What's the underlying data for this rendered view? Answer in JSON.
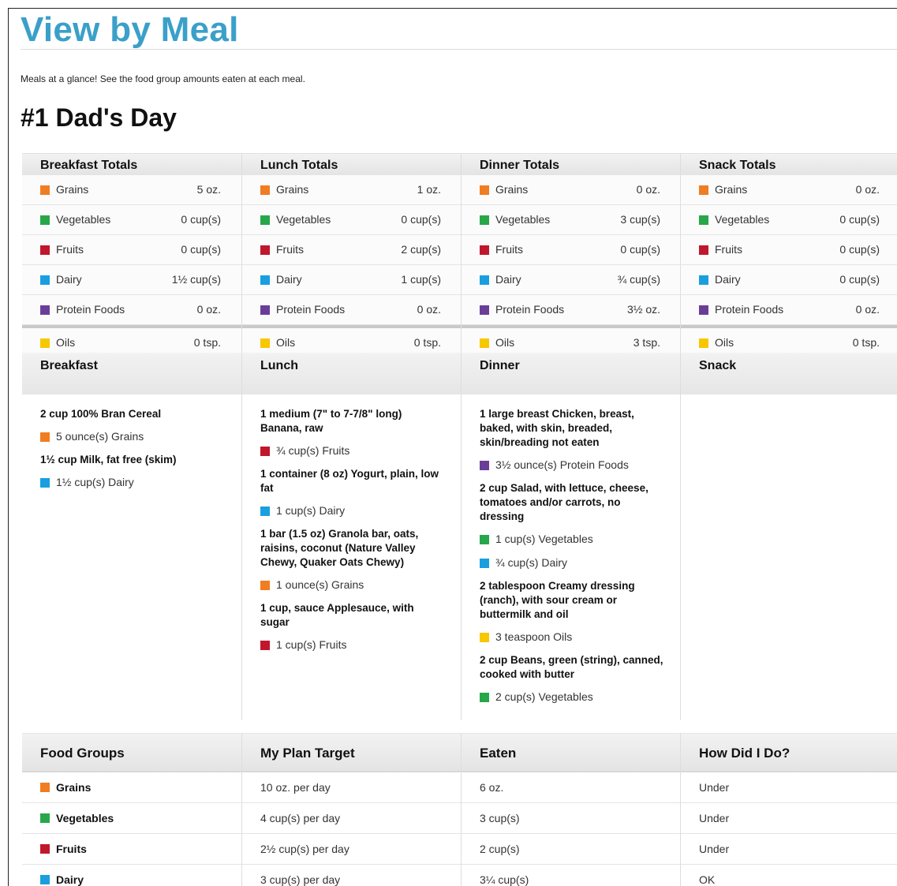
{
  "page": {
    "title": "View by Meal",
    "intro": "Meals at a glance! See the food group amounts eaten at each meal.",
    "day_title": "#1 Dad's Day"
  },
  "colors": {
    "grains": "#f07d22",
    "vegetables": "#27a74a",
    "fruits": "#c0172c",
    "dairy": "#1a9ee0",
    "protein": "#6a3e98",
    "oils": "#f7c700",
    "title": "#3aa0c9"
  },
  "totals": [
    {
      "heading": "Breakfast Totals",
      "rows": [
        {
          "label": "Grains",
          "value": "5 oz."
        },
        {
          "label": "Vegetables",
          "value": "0 cup(s)"
        },
        {
          "label": "Fruits",
          "value": "0 cup(s)"
        },
        {
          "label": "Dairy",
          "value": "1½ cup(s)"
        },
        {
          "label": "Protein Foods",
          "value": "0 oz."
        },
        {
          "label": "Oils",
          "value": "0 tsp."
        }
      ]
    },
    {
      "heading": "Lunch Totals",
      "rows": [
        {
          "label": "Grains",
          "value": "1 oz."
        },
        {
          "label": "Vegetables",
          "value": "0 cup(s)"
        },
        {
          "label": "Fruits",
          "value": "2 cup(s)"
        },
        {
          "label": "Dairy",
          "value": "1 cup(s)"
        },
        {
          "label": "Protein Foods",
          "value": "0 oz."
        },
        {
          "label": "Oils",
          "value": "0 tsp."
        }
      ]
    },
    {
      "heading": "Dinner Totals",
      "rows": [
        {
          "label": "Grains",
          "value": "0 oz."
        },
        {
          "label": "Vegetables",
          "value": "3 cup(s)"
        },
        {
          "label": "Fruits",
          "value": "0 cup(s)"
        },
        {
          "label": "Dairy",
          "value": "¾ cup(s)"
        },
        {
          "label": "Protein Foods",
          "value": "3½ oz."
        },
        {
          "label": "Oils",
          "value": "3 tsp."
        }
      ]
    },
    {
      "heading": "Snack Totals",
      "rows": [
        {
          "label": "Grains",
          "value": "0 oz."
        },
        {
          "label": "Vegetables",
          "value": "0 cup(s)"
        },
        {
          "label": "Fruits",
          "value": "0 cup(s)"
        },
        {
          "label": "Dairy",
          "value": "0 cup(s)"
        },
        {
          "label": "Protein Foods",
          "value": "0 oz."
        },
        {
          "label": "Oils",
          "value": "0 tsp."
        }
      ]
    }
  ],
  "meals": [
    {
      "heading": "Breakfast",
      "items": [
        {
          "food": "2 cup 100% Bran Cereal",
          "amount": "5 ounce(s) Grains",
          "group": "grains"
        },
        {
          "food": "1½ cup Milk, fat free (skim)",
          "amount": "1½ cup(s) Dairy",
          "group": "dairy"
        }
      ]
    },
    {
      "heading": "Lunch",
      "items": [
        {
          "food": "1 medium (7\" to 7-7/8\" long) Banana, raw",
          "amount": "¾ cup(s) Fruits",
          "group": "fruits"
        },
        {
          "food": "1 container (8 oz) Yogurt, plain, low fat",
          "amount": "1 cup(s) Dairy",
          "group": "dairy"
        },
        {
          "food": "1 bar (1.5 oz) Granola bar, oats, raisins, coconut (Nature Valley Chewy, Quaker Oats Chewy)",
          "amount": "1 ounce(s) Grains",
          "group": "grains"
        },
        {
          "food": "1 cup, sauce Applesauce, with sugar",
          "amount": "1 cup(s) Fruits",
          "group": "fruits"
        }
      ]
    },
    {
      "heading": "Dinner",
      "items": [
        {
          "food": "1 large breast Chicken, breast, baked, with skin, breaded, skin/breading not eaten",
          "amount": "3½ ounce(s) Protein Foods",
          "group": "protein"
        },
        {
          "food": "2 cup Salad, with lettuce, cheese, tomatoes and/or carrots, no dressing",
          "amount": "1 cup(s) Vegetables",
          "group": "vegetables",
          "amount2": "¾ cup(s) Dairy",
          "group2": "dairy"
        },
        {
          "food": "2 tablespoon Creamy dressing (ranch), with sour cream or buttermilk and oil",
          "amount": "3 teaspoon Oils",
          "group": "oils"
        },
        {
          "food": "2 cup Beans, green (string), canned, cooked with butter",
          "amount": "2 cup(s) Vegetables",
          "group": "vegetables"
        }
      ]
    },
    {
      "heading": "Snack",
      "items": []
    }
  ],
  "food_groups": {
    "headers": [
      "Food Groups",
      "My Plan Target",
      "Eaten",
      "How Did I Do?"
    ],
    "rows": [
      {
        "group": "Grains",
        "key": "grains",
        "target": "10 oz. per day",
        "eaten": "6 oz.",
        "result": "Under"
      },
      {
        "group": "Vegetables",
        "key": "vegetables",
        "target": "4 cup(s) per day",
        "eaten": "3 cup(s)",
        "result": "Under"
      },
      {
        "group": "Fruits",
        "key": "fruits",
        "target": "2½ cup(s) per day",
        "eaten": "2 cup(s)",
        "result": "Under"
      },
      {
        "group": "Dairy",
        "key": "dairy",
        "target": "3 cup(s) per day",
        "eaten": "3¼ cup(s)",
        "result": "OK"
      }
    ]
  }
}
